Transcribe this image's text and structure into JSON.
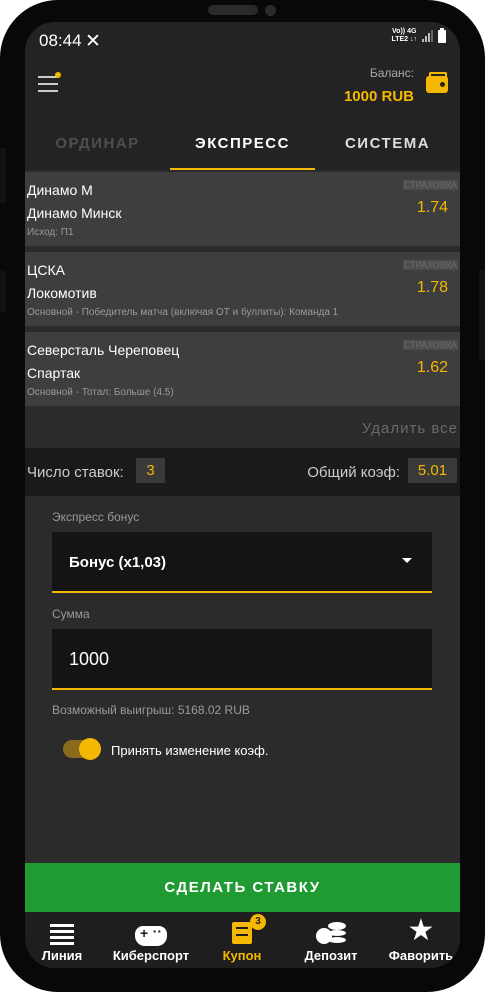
{
  "status_bar": {
    "time": "08:44",
    "net_top": "Vo))  4G",
    "net_bottom": "LTE2 ↓↑"
  },
  "header": {
    "balance_label": "Баланс:",
    "balance_value": "1000 RUB"
  },
  "tabs": [
    {
      "label": "ОРДИНАР"
    },
    {
      "label": "ЭКСПРЕСС"
    },
    {
      "label": "СИСТЕМА"
    }
  ],
  "bets": [
    {
      "team1": "Динамо М",
      "team2": "Динамо Минск",
      "outcome": "Исход: П1",
      "tag": "СТРАХОВКА",
      "coef": "1.74"
    },
    {
      "team1": "ЦСКА",
      "team2": "Локомотив",
      "outcome": "Основной - Победитель матча (включая ОТ и буллиты): Команда 1",
      "tag": "СТРАХОВКА",
      "coef": "1.78"
    },
    {
      "team1": "Северсталь Череповец",
      "team2": "Спартак",
      "outcome": "Основной -  Тотал: Больше (4.5)",
      "tag": "СТРАХОВКА",
      "coef": "1.62"
    }
  ],
  "delete_all": "Удалить все",
  "summary": {
    "count_label": "Число ставок:",
    "count_value": "3",
    "total_coef_label": "Общий коэф:",
    "total_coef_value": "5.01"
  },
  "form": {
    "bonus_label": "Экспресс бонус",
    "bonus_value": "Бонус (x1,03)",
    "amount_label": "Сумма",
    "amount_value": "1000",
    "possible_win": "Возможный выигрыш: 5168.02 RUB",
    "accept_change_label": "Принять изменение коэф.",
    "accept_change_on": true
  },
  "submit_label": "СДЕЛАТЬ СТАВКУ",
  "bottom_nav": {
    "items": [
      {
        "label": "Линия",
        "icon": "list-icon"
      },
      {
        "label": "Киберспорт",
        "icon": "gamepad-icon"
      },
      {
        "label": "Купон",
        "icon": "coupon-icon",
        "badge": "3"
      },
      {
        "label": "Депозит",
        "icon": "deposit-icon"
      },
      {
        "label": "Фаворить",
        "icon": "star-icon"
      }
    ]
  },
  "colors": {
    "accent": "#f5b800",
    "submit": "#209a32",
    "background": "#2b2b2b"
  }
}
